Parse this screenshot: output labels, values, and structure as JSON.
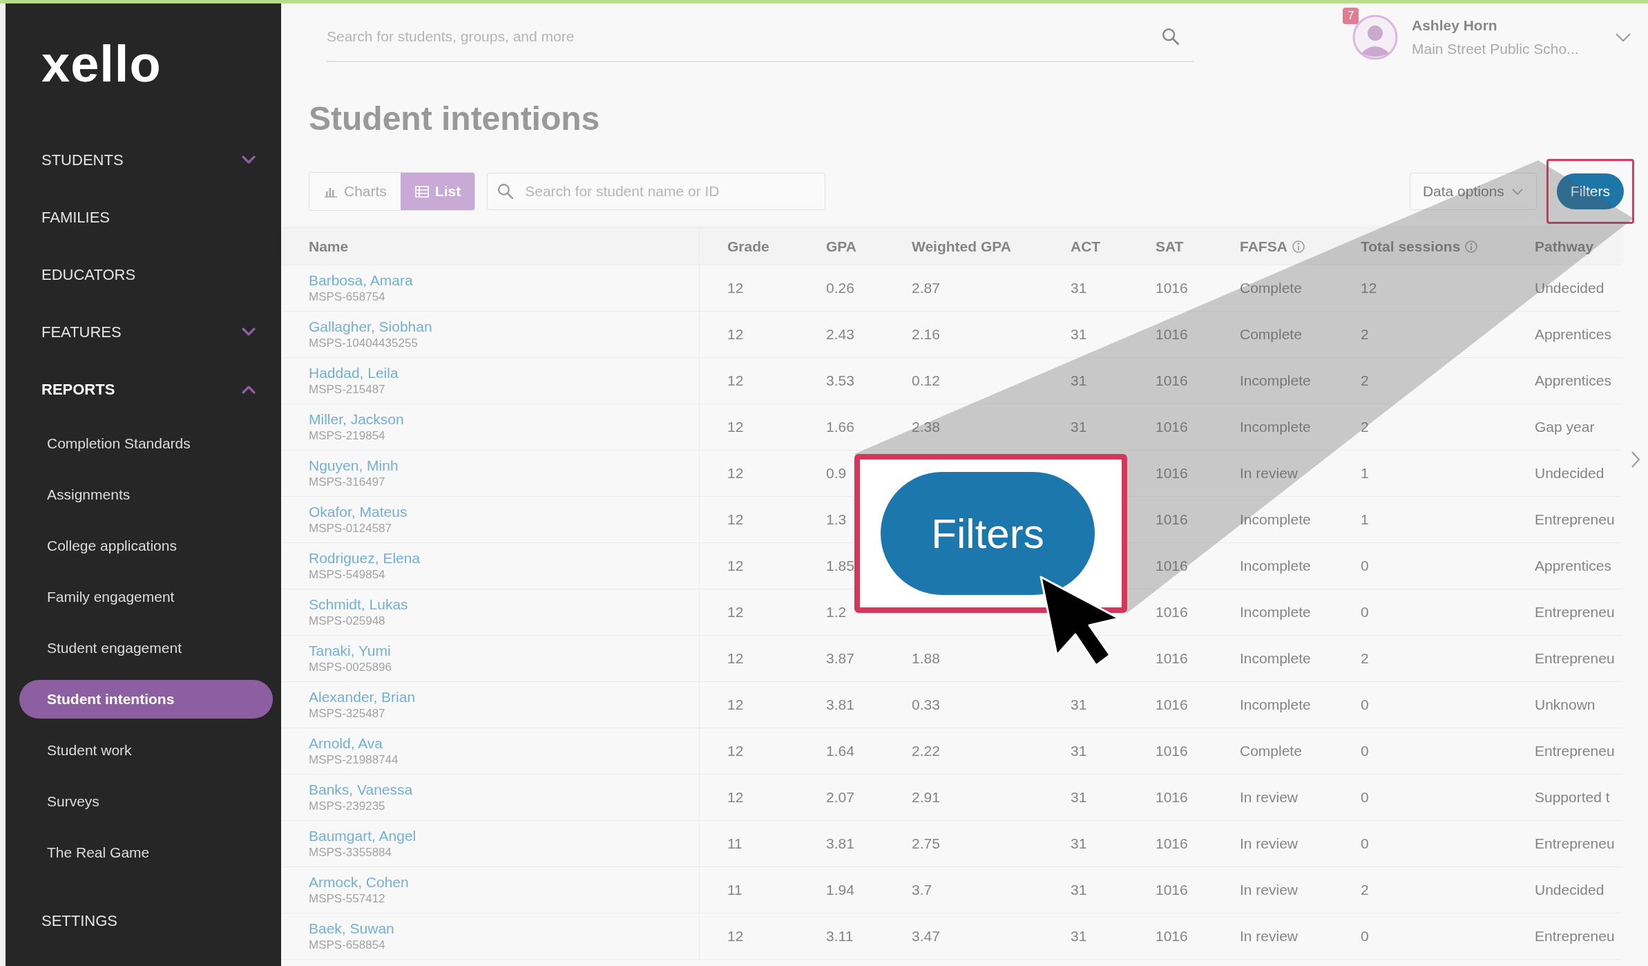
{
  "sidebar": {
    "logo": "xello",
    "items": [
      {
        "label": "STUDENTS",
        "kind": "section",
        "expanded": false,
        "selected": false
      },
      {
        "label": "FAMILIES",
        "kind": "link",
        "selected": false
      },
      {
        "label": "EDUCATORS",
        "kind": "link",
        "selected": false
      },
      {
        "label": "FEATURES",
        "kind": "section",
        "expanded": false,
        "selected": false
      },
      {
        "label": "REPORTS",
        "kind": "section",
        "expanded": true,
        "selected": false,
        "children": [
          {
            "label": "Completion Standards",
            "selected": false
          },
          {
            "label": "Assignments",
            "selected": false
          },
          {
            "label": "College applications",
            "selected": false
          },
          {
            "label": "Family engagement",
            "selected": false
          },
          {
            "label": "Student engagement",
            "selected": false
          },
          {
            "label": "Student intentions",
            "selected": true
          },
          {
            "label": "Student work",
            "selected": false
          },
          {
            "label": "Surveys",
            "selected": false
          },
          {
            "label": "The Real Game",
            "selected": false
          }
        ]
      },
      {
        "label": "SETTINGS",
        "kind": "link",
        "selected": false
      }
    ]
  },
  "top_bar": {
    "search": {
      "placeholder": "Search for students, groups, and more"
    },
    "user": {
      "notifications": "7",
      "name": "Ashley Horn",
      "school": "Main Street Public Scho..."
    }
  },
  "page_title": "Student intentions",
  "toolbar": {
    "views": [
      {
        "label": "Charts",
        "kind": "chart",
        "selected": false
      },
      {
        "label": "List",
        "kind": "list",
        "selected": true
      }
    ],
    "search": {
      "placeholder": "Search for student name or ID"
    },
    "data_options": "Data options",
    "filters": "Filters"
  },
  "table": {
    "columns": [
      {
        "label": "Name"
      },
      {
        "label": "Grade"
      },
      {
        "label": "GPA"
      },
      {
        "label": "Weighted GPA"
      },
      {
        "label": "ACT"
      },
      {
        "label": "SAT"
      },
      {
        "label": "FAFSA",
        "info": true
      },
      {
        "label": "Total sessions",
        "info": true
      },
      {
        "label": "Pathway"
      }
    ],
    "rows": [
      {
        "cells": [
          {
            "name": "Barbosa, Amara",
            "number": "MSPS-658754"
          },
          "12",
          "0.26",
          "2.87",
          "31",
          "1016",
          "Complete",
          "12",
          "Undecided"
        ]
      },
      {
        "cells": [
          {
            "name": "Gallagher, Siobhan",
            "number": "MSPS-10404435255"
          },
          "12",
          "2.43",
          "2.16",
          "31",
          "1016",
          "Complete",
          "2",
          "Apprentices"
        ]
      },
      {
        "cells": [
          {
            "name": "Haddad, Leila",
            "number": "MSPS-215487"
          },
          "12",
          "3.53",
          "0.12",
          "31",
          "1016",
          "Incomplete",
          "2",
          "Apprentices"
        ]
      },
      {
        "cells": [
          {
            "name": "Miller, Jackson",
            "number": "MSPS-219854"
          },
          "12",
          "1.66",
          "2.38",
          "31",
          "1016",
          "Incomplete",
          "2",
          "Gap year"
        ]
      },
      {
        "cells": [
          {
            "name": "Nguyen, Minh",
            "number": "MSPS-316497"
          },
          "12",
          "0.9",
          null,
          null,
          "1016",
          "In review",
          "1",
          "Undecided"
        ]
      },
      {
        "cells": [
          {
            "name": "Okafor, Mateus",
            "number": "MSPS-0124587"
          },
          "12",
          "1.3",
          null,
          null,
          "1016",
          "Incomplete",
          "1",
          "Entrepreneu"
        ]
      },
      {
        "cells": [
          {
            "name": "Rodriguez, Elena",
            "number": "MSPS-549854"
          },
          "12",
          "1.85",
          null,
          null,
          "1016",
          "Incomplete",
          "0",
          "Apprentices"
        ]
      },
      {
        "cells": [
          {
            "name": "Schmidt, Lukas",
            "number": "MSPS-025948"
          },
          "12",
          "1.2",
          null,
          null,
          "1016",
          "Incomplete",
          "0",
          "Entrepreneu"
        ]
      },
      {
        "cells": [
          {
            "name": "Tanaki, Yumi",
            "number": "MSPS-0025896"
          },
          "12",
          "3.87",
          "1.88",
          null,
          "1016",
          "Incomplete",
          "2",
          "Entrepreneu"
        ]
      },
      {
        "cells": [
          {
            "name": "Alexander, Brian",
            "number": "MSPS-325487"
          },
          "12",
          "3.81",
          "0.33",
          "31",
          "1016",
          "Incomplete",
          "0",
          "Unknown"
        ]
      },
      {
        "cells": [
          {
            "name": "Arnold, Ava",
            "number": "MSPS-21988744"
          },
          "12",
          "1.64",
          "2.22",
          "31",
          "1016",
          "Complete",
          "0",
          "Entrepreneu"
        ]
      },
      {
        "cells": [
          {
            "name": "Banks, Vanessa",
            "number": "MSPS-239235"
          },
          "12",
          "2.07",
          "2.91",
          "31",
          "1016",
          "In review",
          "0",
          "Supported t"
        ]
      },
      {
        "cells": [
          {
            "name": "Baumgart, Angel",
            "number": "MSPS-3355884"
          },
          "11",
          "3.81",
          "2.75",
          "31",
          "1016",
          "In review",
          "0",
          "Entrepreneu"
        ]
      },
      {
        "cells": [
          {
            "name": "Armock, Cohen",
            "number": "MSPS-557412"
          },
          "11",
          "1.94",
          "3.7",
          "31",
          "1016",
          "In review",
          "2",
          "Undecided"
        ]
      },
      {
        "cells": [
          {
            "name": "Baek, Suwan",
            "number": "MSPS-658854"
          },
          "12",
          "3.11",
          "3.47",
          "31",
          "1016",
          "In review",
          "0",
          "Entrepreneu"
        ]
      }
    ]
  },
  "callout": {
    "label": "Filters"
  }
}
